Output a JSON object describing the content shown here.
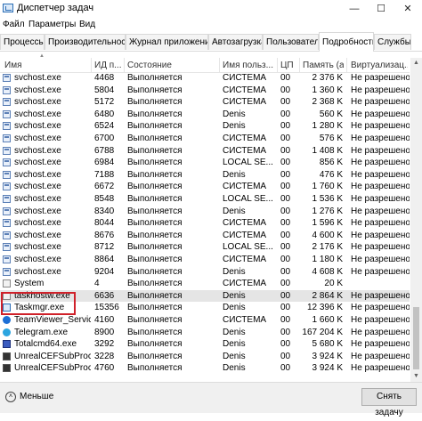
{
  "window": {
    "title": "Диспетчер задач",
    "controls": {
      "minimize": "—",
      "maximize": "☐",
      "close": "✕"
    }
  },
  "menu": [
    "Файл",
    "Параметры",
    "Вид"
  ],
  "tabs": [
    "Процессы",
    "Производительность",
    "Журнал приложений",
    "Автозагрузка",
    "Пользователи",
    "Подробности",
    "Службы"
  ],
  "active_tab": "Подробности",
  "columns": [
    "Имя",
    "ИД п...",
    "Состояние",
    "Имя польз...",
    "ЦП",
    "Память (а...",
    "Виртуализац..."
  ],
  "rows": [
    {
      "icon": "service-icon",
      "name": "svchost.exe",
      "pid": "4468",
      "status": "Выполняется",
      "user": "СИСТЕМА",
      "cpu": "00",
      "mem": "2 376 K",
      "virt": "Не разрешено"
    },
    {
      "icon": "service-icon",
      "name": "svchost.exe",
      "pid": "5804",
      "status": "Выполняется",
      "user": "СИСТЕМА",
      "cpu": "00",
      "mem": "1 360 K",
      "virt": "Не разрешено"
    },
    {
      "icon": "service-icon",
      "name": "svchost.exe",
      "pid": "5172",
      "status": "Выполняется",
      "user": "СИСТЕМА",
      "cpu": "00",
      "mem": "2 368 K",
      "virt": "Не разрешено"
    },
    {
      "icon": "service-icon",
      "name": "svchost.exe",
      "pid": "6480",
      "status": "Выполняется",
      "user": "Denis",
      "cpu": "00",
      "mem": "560 K",
      "virt": "Не разрешено"
    },
    {
      "icon": "service-icon",
      "name": "svchost.exe",
      "pid": "6524",
      "status": "Выполняется",
      "user": "Denis",
      "cpu": "00",
      "mem": "1 280 K",
      "virt": "Не разрешено"
    },
    {
      "icon": "service-icon",
      "name": "svchost.exe",
      "pid": "6700",
      "status": "Выполняется",
      "user": "СИСТЕМА",
      "cpu": "00",
      "mem": "576 K",
      "virt": "Не разрешено"
    },
    {
      "icon": "service-icon",
      "name": "svchost.exe",
      "pid": "6788",
      "status": "Выполняется",
      "user": "СИСТЕМА",
      "cpu": "00",
      "mem": "1 408 K",
      "virt": "Не разрешено"
    },
    {
      "icon": "service-icon",
      "name": "svchost.exe",
      "pid": "6984",
      "status": "Выполняется",
      "user": "LOCAL SE...",
      "cpu": "00",
      "mem": "856 K",
      "virt": "Не разрешено"
    },
    {
      "icon": "service-icon",
      "name": "svchost.exe",
      "pid": "7188",
      "status": "Выполняется",
      "user": "Denis",
      "cpu": "00",
      "mem": "476 K",
      "virt": "Не разрешено"
    },
    {
      "icon": "service-icon",
      "name": "svchost.exe",
      "pid": "6672",
      "status": "Выполняется",
      "user": "СИСТЕМА",
      "cpu": "00",
      "mem": "1 760 K",
      "virt": "Не разрешено"
    },
    {
      "icon": "service-icon",
      "name": "svchost.exe",
      "pid": "8548",
      "status": "Выполняется",
      "user": "LOCAL SE...",
      "cpu": "00",
      "mem": "1 536 K",
      "virt": "Не разрешено"
    },
    {
      "icon": "service-icon",
      "name": "svchost.exe",
      "pid": "8340",
      "status": "Выполняется",
      "user": "Denis",
      "cpu": "00",
      "mem": "1 276 K",
      "virt": "Не разрешено"
    },
    {
      "icon": "service-icon",
      "name": "svchost.exe",
      "pid": "8044",
      "status": "Выполняется",
      "user": "СИСТЕМА",
      "cpu": "00",
      "mem": "1 596 K",
      "virt": "Не разрешено"
    },
    {
      "icon": "service-icon",
      "name": "svchost.exe",
      "pid": "8676",
      "status": "Выполняется",
      "user": "СИСТЕМА",
      "cpu": "00",
      "mem": "4 600 K",
      "virt": "Не разрешено"
    },
    {
      "icon": "service-icon",
      "name": "svchost.exe",
      "pid": "8712",
      "status": "Выполняется",
      "user": "LOCAL SE...",
      "cpu": "00",
      "mem": "2 176 K",
      "virt": "Не разрешено"
    },
    {
      "icon": "service-icon",
      "name": "svchost.exe",
      "pid": "8864",
      "status": "Выполняется",
      "user": "СИСТЕМА",
      "cpu": "00",
      "mem": "1 180 K",
      "virt": "Не разрешено"
    },
    {
      "icon": "service-icon",
      "name": "svchost.exe",
      "pid": "9204",
      "status": "Выполняется",
      "user": "Denis",
      "cpu": "00",
      "mem": "4 608 K",
      "virt": "Не разрешено"
    },
    {
      "icon": "system-icon",
      "name": "System",
      "pid": "4",
      "status": "Выполняется",
      "user": "СИСТЕМА",
      "cpu": "00",
      "mem": "20 K",
      "virt": ""
    },
    {
      "icon": "system-icon",
      "name": "taskhostw.exe",
      "pid": "6636",
      "status": "Выполняется",
      "user": "Denis",
      "cpu": "00",
      "mem": "2 864 K",
      "virt": "Не разрешено"
    },
    {
      "icon": "taskmgr-icon",
      "name": "Taskmgr.exe",
      "pid": "15356",
      "status": "Выполняется",
      "user": "Denis",
      "cpu": "00",
      "mem": "12 396 K",
      "virt": "Не разрешено"
    },
    {
      "icon": "teamviewer-icon",
      "name": "TeamViewer_Service....",
      "pid": "4160",
      "status": "Выполняется",
      "user": "СИСТЕМА",
      "cpu": "00",
      "mem": "1 660 K",
      "virt": "Не разрешено"
    },
    {
      "icon": "telegram-icon",
      "name": "Telegram.exe",
      "pid": "8900",
      "status": "Выполняется",
      "user": "Denis",
      "cpu": "00",
      "mem": "167 204 K",
      "virt": "Не разрешено"
    },
    {
      "icon": "totalcmd-icon",
      "name": "Totalcmd64.exe",
      "pid": "3292",
      "status": "Выполняется",
      "user": "Denis",
      "cpu": "00",
      "mem": "5 680 K",
      "virt": "Не разрешено"
    },
    {
      "icon": "unreal-icon",
      "name": "UnrealCEFSubProces...",
      "pid": "3228",
      "status": "Выполняется",
      "user": "Denis",
      "cpu": "00",
      "mem": "3 924 K",
      "virt": "Не разрешено"
    },
    {
      "icon": "unreal-icon",
      "name": "UnrealCEFSubProces...",
      "pid": "4760",
      "status": "Выполняется",
      "user": "Denis",
      "cpu": "00",
      "mem": "3 924 K",
      "virt": "Не разрешено"
    }
  ],
  "selected_row": "taskhostw.exe",
  "footer": {
    "less_label": "Меньше",
    "end_task_label": "Снять задачу"
  },
  "colors": {
    "highlight": "#d0212a",
    "selected_row": "#e5e5e5"
  }
}
